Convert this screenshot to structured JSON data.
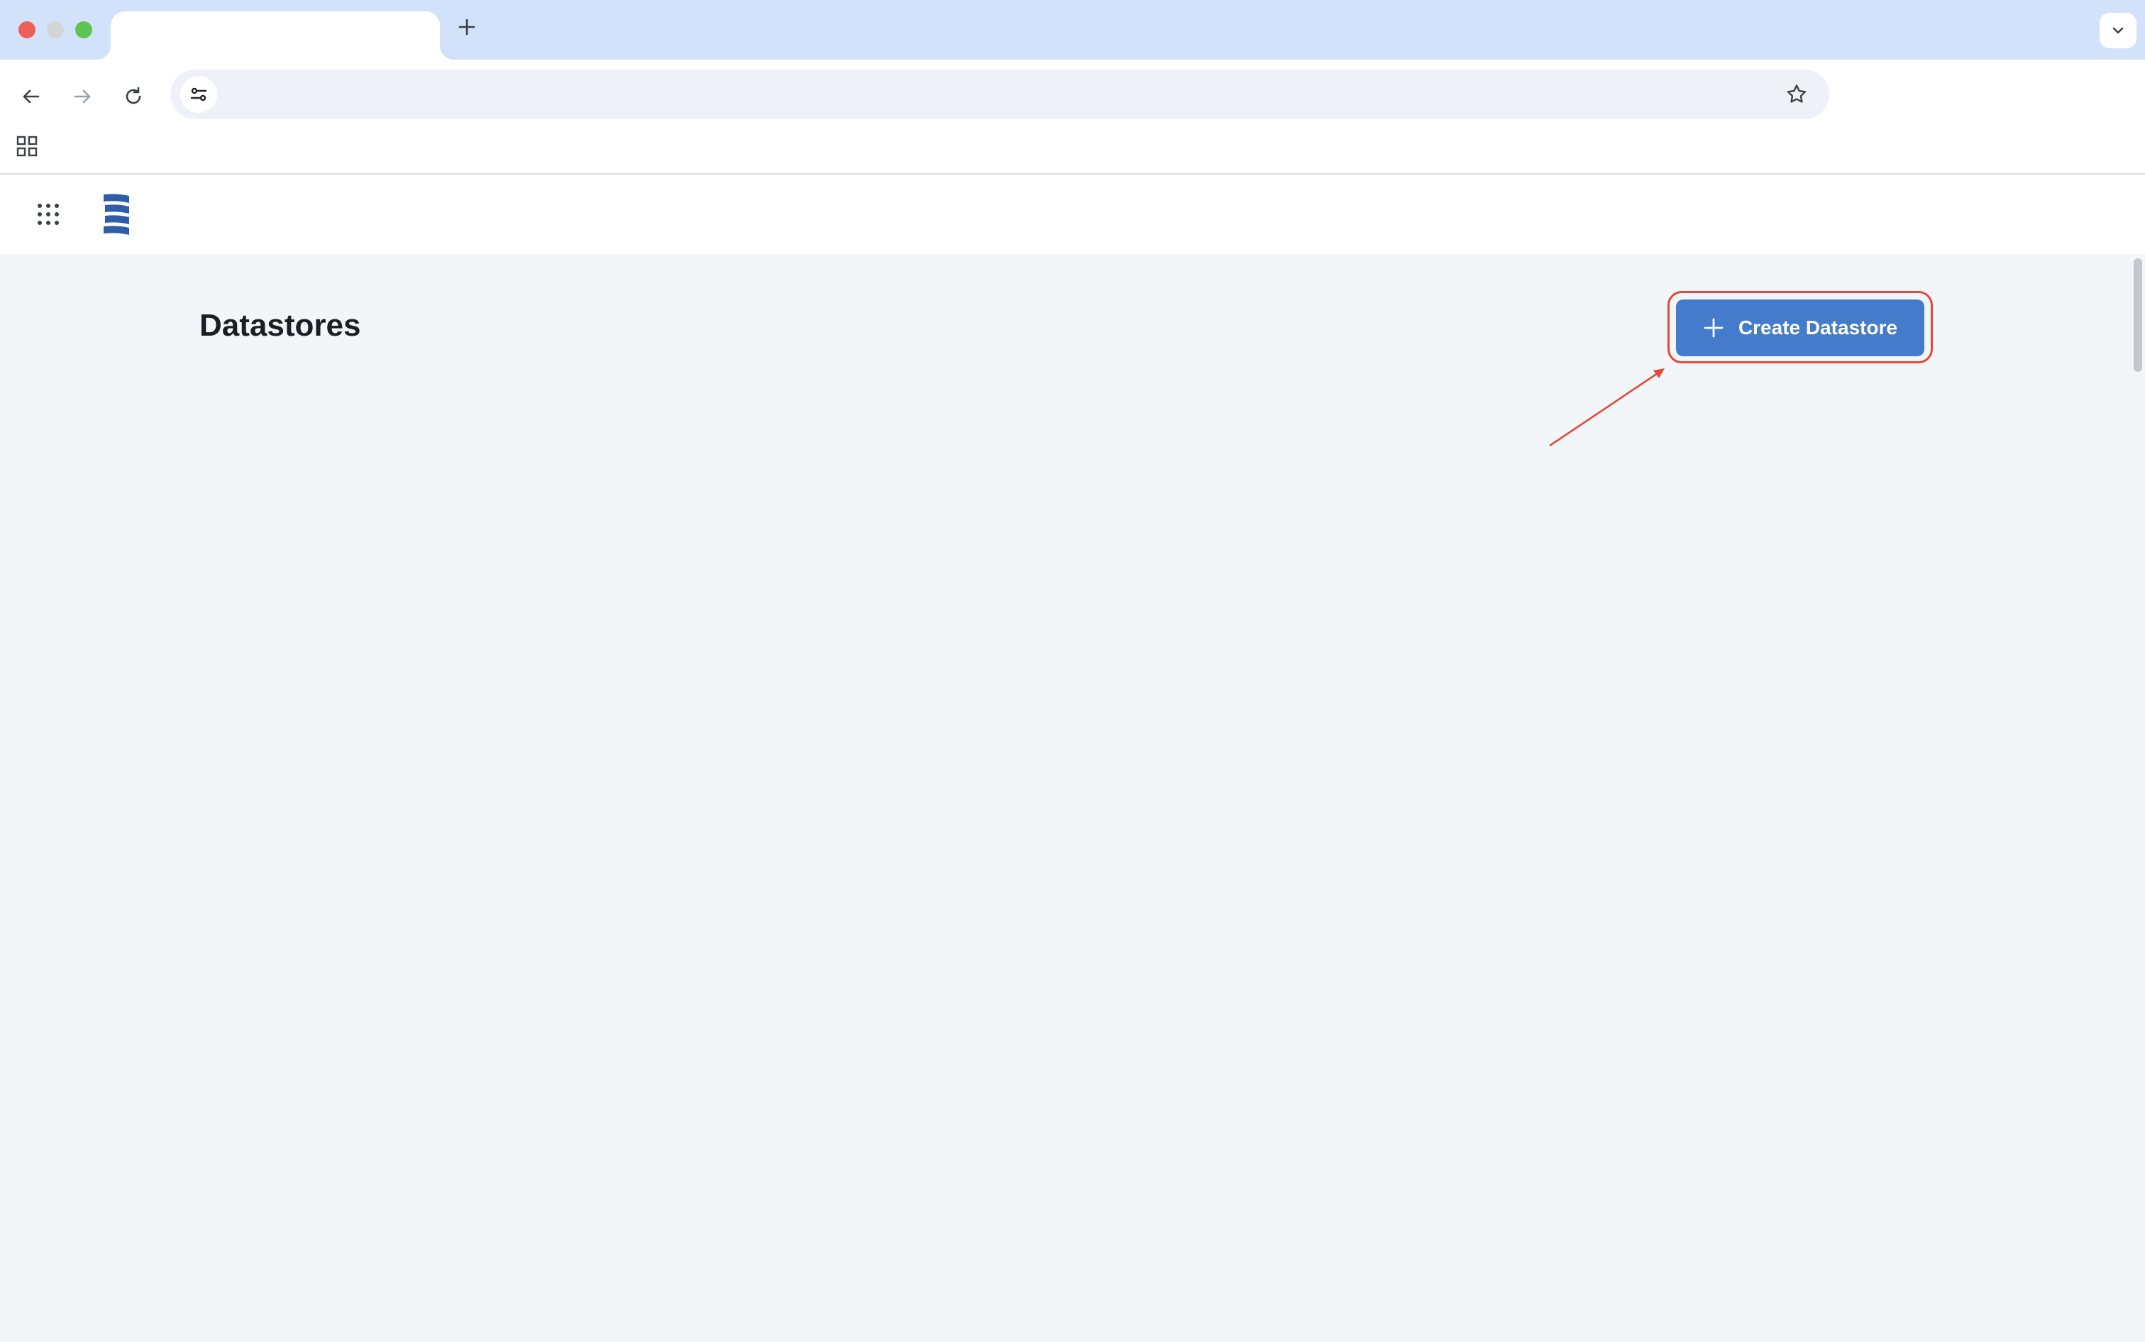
{
  "browser": {
    "tab_title": "",
    "address": "",
    "window_controls": [
      "close",
      "minimize",
      "maximize"
    ],
    "icons": {
      "new_tab": "plus-icon",
      "tab_list": "chevron-down-icon",
      "back": "arrow-left-icon",
      "forward": "arrow-right-icon",
      "reload": "reload-icon",
      "site_info": "tune-icon",
      "bookmark": "star-icon",
      "apps": "grid-icon"
    }
  },
  "app": {
    "launcher_icon": "dots-grid-icon",
    "logo": "stack-logo"
  },
  "page": {
    "title": "Datastores",
    "create_button_label": "Create Datastore",
    "create_button_icon": "plus-icon"
  },
  "colors": {
    "tabstrip": "#d3e2fb",
    "page_bg": "#f3f6f9",
    "primary_button": "#447ccb",
    "annotation": "#e14a3a",
    "logo": "#2e5ea8"
  }
}
